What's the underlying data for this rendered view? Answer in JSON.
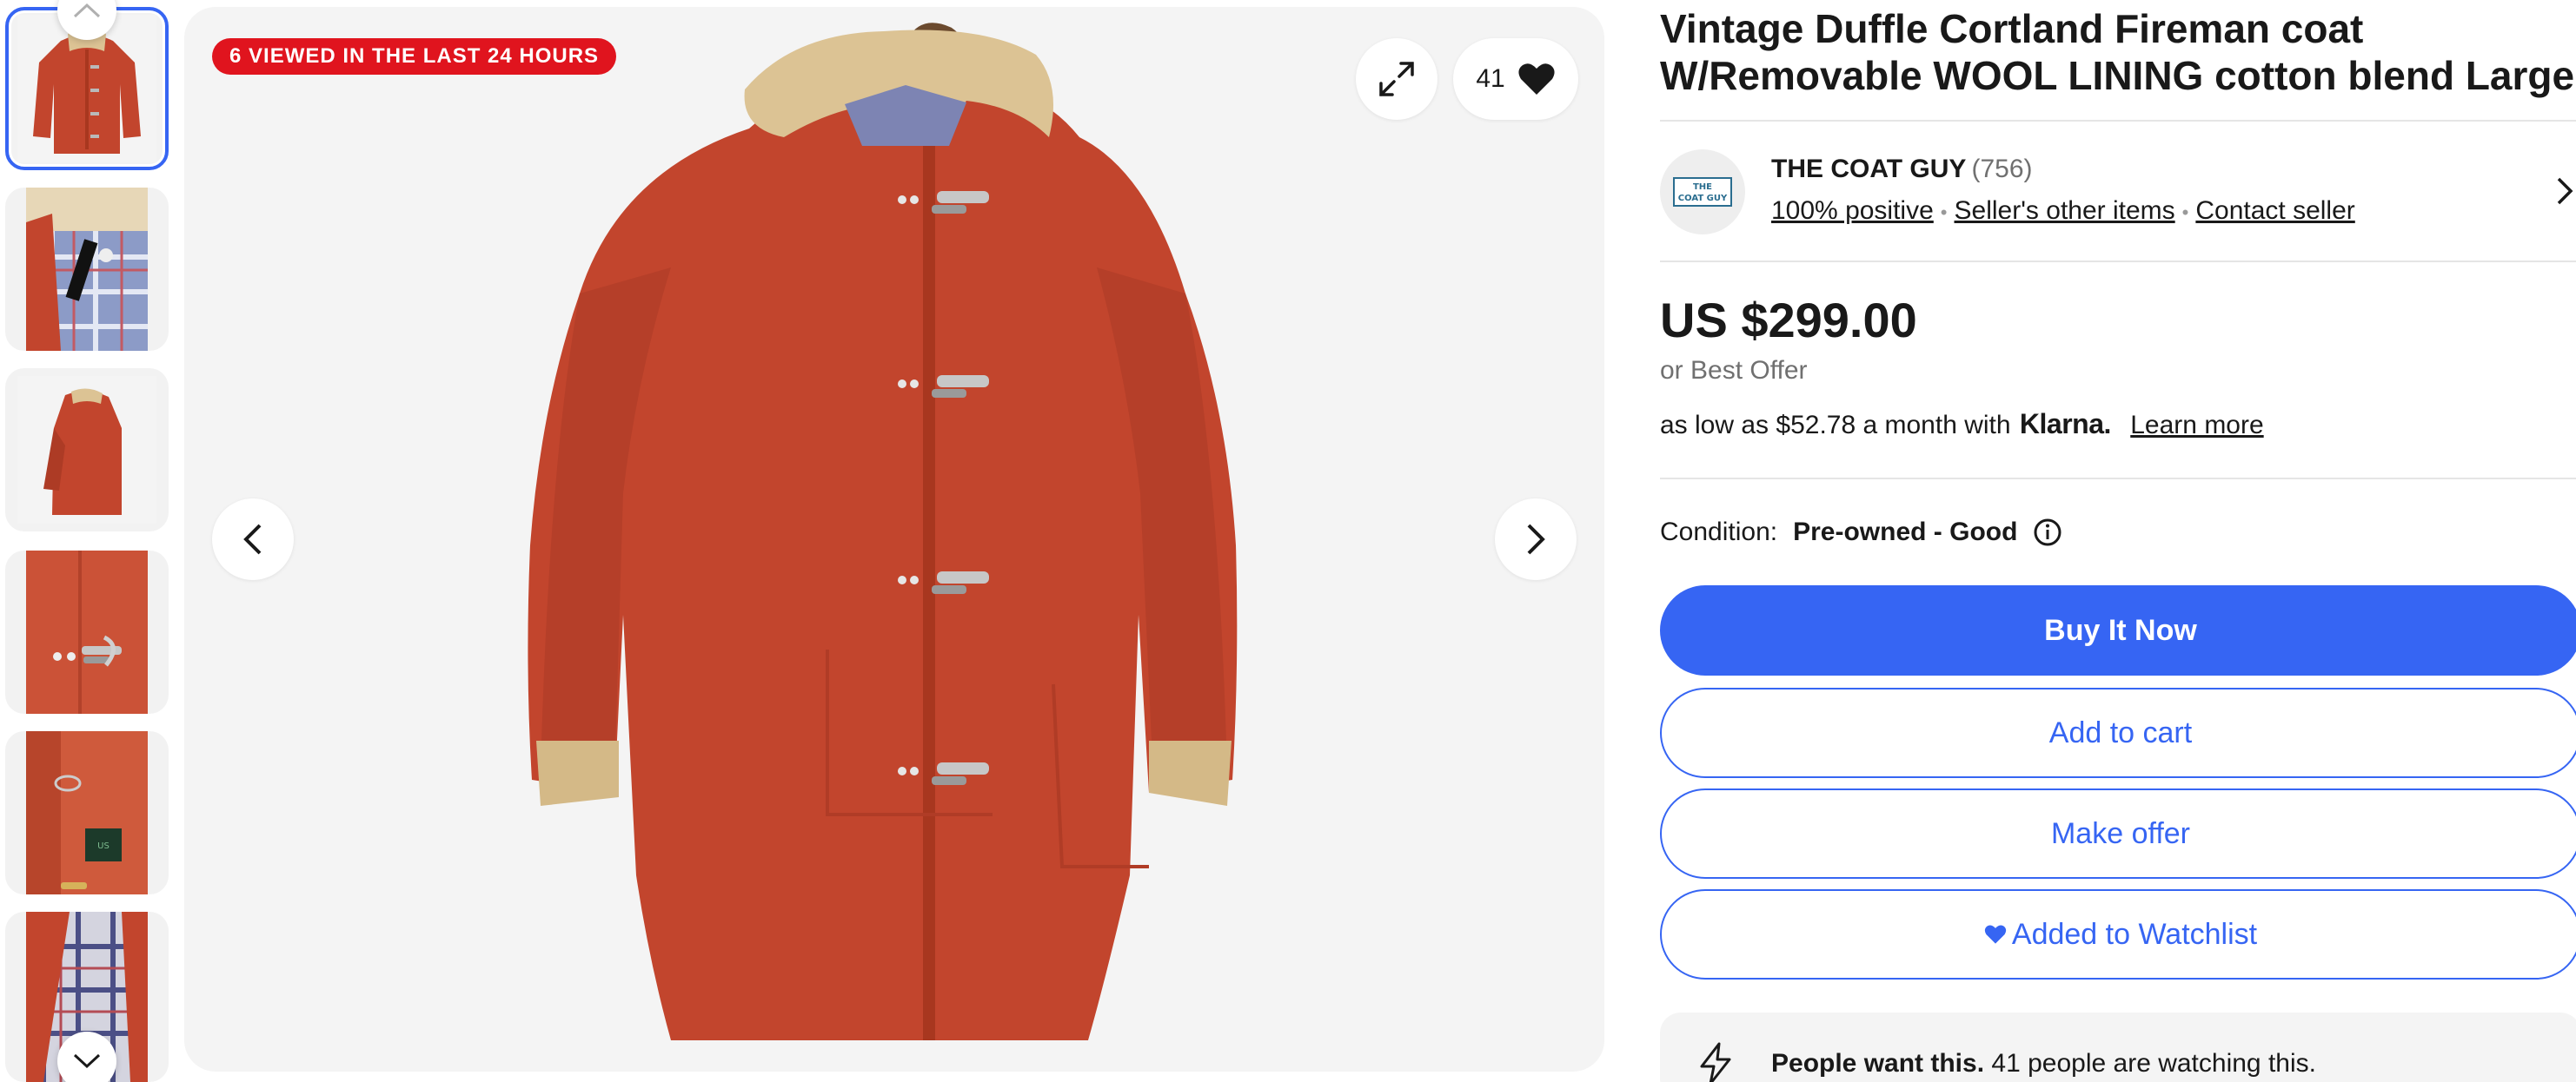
{
  "gallery": {
    "badge": "6 VIEWED IN THE LAST 24 HOURS",
    "watch_count": "41",
    "thumbnails": [
      {
        "name": "coat-front"
      },
      {
        "name": "coat-collar-lining"
      },
      {
        "name": "coat-side"
      },
      {
        "name": "coat-clasp-detail"
      },
      {
        "name": "coat-label"
      },
      {
        "name": "coat-lining-plaid"
      }
    ],
    "selected_thumbnail": 1
  },
  "listing": {
    "title": "Vintage Duffle Cortland Fireman coat W/Removable WOOL LINING cotton blend Large",
    "price": "US $299.00",
    "best_offer": "or Best Offer",
    "financing_prefix": "as low as $52.78 a month with",
    "financing_brand": "Klarna.",
    "financing_link": "Learn more",
    "condition_label": "Condition:",
    "condition_value": "Pre-owned - Good"
  },
  "seller": {
    "name": "THE COAT GUY",
    "feedback_count": "(756)",
    "positive": "100% positive",
    "other_items": "Seller's other items",
    "contact": "Contact seller",
    "logo_text_top": "THE",
    "logo_text_bottom": "COAT GUY"
  },
  "actions": {
    "buy_now": "Buy It Now",
    "add_to_cart": "Add to cart",
    "make_offer": "Make offer",
    "watchlist": "Added to Watchlist"
  },
  "social_proof": {
    "headline": "People want this.",
    "detail": "41 people are watching this."
  },
  "colors": {
    "accent": "#3665f3",
    "badge": "#e0141e",
    "coat": "#c2452d",
    "collar": "#dcc394"
  }
}
